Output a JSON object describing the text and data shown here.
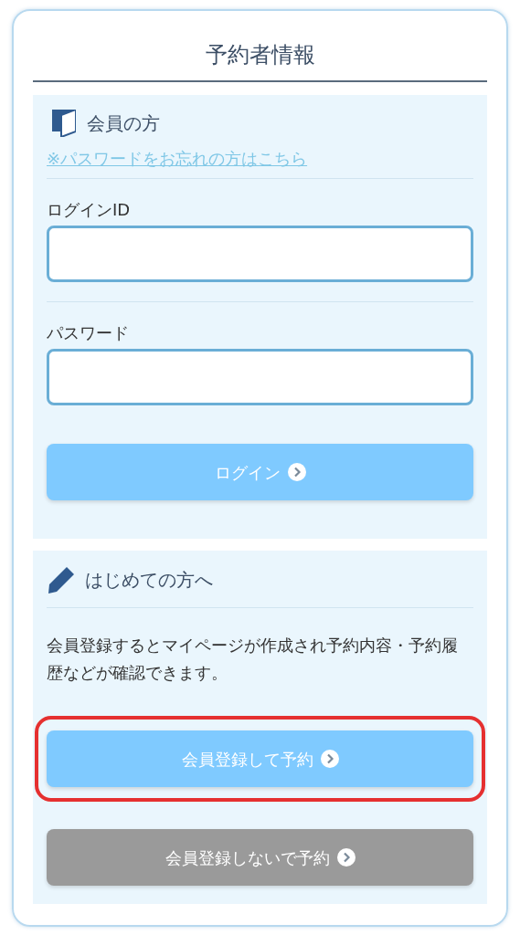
{
  "title": "予約者情報",
  "member": {
    "heading": "会員の方",
    "forgot_link": "※パスワードをお忘れの方はこちら",
    "fields": [
      {
        "label": "ログインID"
      },
      {
        "label": "パスワード"
      }
    ],
    "login_button": {
      "label": "ログイン",
      "kind": "primary"
    }
  },
  "first_time": {
    "heading": "はじめての方へ",
    "description": "会員登録するとマイページが作成され予約内容・予約履歴などが確認できます。",
    "buttons": [
      {
        "label": "会員登録して予約",
        "kind": "primary",
        "highlighted": true
      },
      {
        "label": "会員登録しないで予約",
        "kind": "secondary",
        "highlighted": false
      }
    ]
  }
}
